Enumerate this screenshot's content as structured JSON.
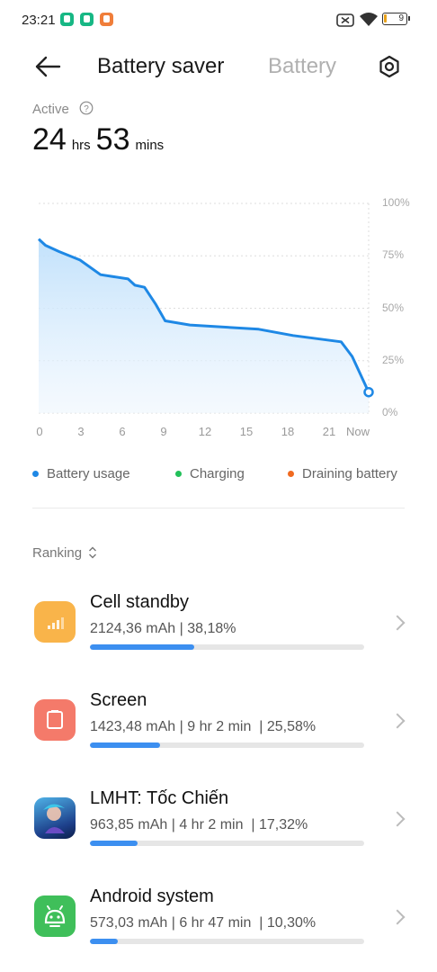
{
  "status_bar": {
    "time": "23:21",
    "battery_level": "9"
  },
  "header": {
    "title": "Battery saver",
    "tab": "Battery"
  },
  "summary": {
    "active_label": "Active",
    "hours_value": "24",
    "hours_unit": "hrs",
    "minutes_value": "53",
    "minutes_unit": "mins"
  },
  "chart_data": {
    "type": "area",
    "y_tick_labels": [
      "100%",
      "75%",
      "50%",
      "25%",
      "0%"
    ],
    "x_tick_labels": [
      "0",
      "3",
      "6",
      "9",
      "12",
      "15",
      "18",
      "21",
      "Now"
    ],
    "ylim": [
      0,
      100
    ],
    "xlim": [
      0,
      24
    ],
    "series": [
      {
        "name": "Battery usage",
        "x": [
          0,
          0.5,
          1.5,
          3,
          4.5,
          6.5,
          7,
          7.7,
          8.5,
          9.2,
          11,
          16,
          18.5,
          22,
          22.8,
          24
        ],
        "y": [
          83,
          80,
          77,
          73,
          66,
          64,
          61,
          60,
          52,
          44,
          42,
          40,
          37,
          34,
          27,
          10
        ]
      }
    ],
    "grid": true,
    "colors": {
      "line": "#1e88e5",
      "fill": "#cfe6fb",
      "grid": "#dddddd"
    }
  },
  "legend": [
    {
      "label": "Battery usage",
      "color": "#1e88e5"
    },
    {
      "label": "Charging",
      "color": "#22c05a"
    },
    {
      "label": "Draining battery",
      "color": "#f06a20"
    }
  ],
  "ranking": {
    "label": "Ranking",
    "items": [
      {
        "name": "Cell standby",
        "detail": "2124,36 mAh | 38,18%",
        "percent": 0.3818,
        "icon": "signal-icon",
        "icon_color": "#f9b44a"
      },
      {
        "name": "Screen",
        "detail": "1423,48 mAh | 9 hr 2 min  | 25,58%",
        "percent": 0.2558,
        "icon": "phone-screen-icon",
        "icon_color": "#f47a6a"
      },
      {
        "name": "LMHT: Tốc Chiến",
        "detail": "963,85 mAh | 4 hr 2 min  | 17,32%",
        "percent": 0.1732,
        "icon": "game-app-icon",
        "icon_color": "#2a7bd0"
      },
      {
        "name": "Android system",
        "detail": "573,03 mAh | 6 hr 47 min  | 10,30%",
        "percent": 0.103,
        "icon": "android-icon",
        "icon_color": "#3fbf5a"
      }
    ]
  }
}
